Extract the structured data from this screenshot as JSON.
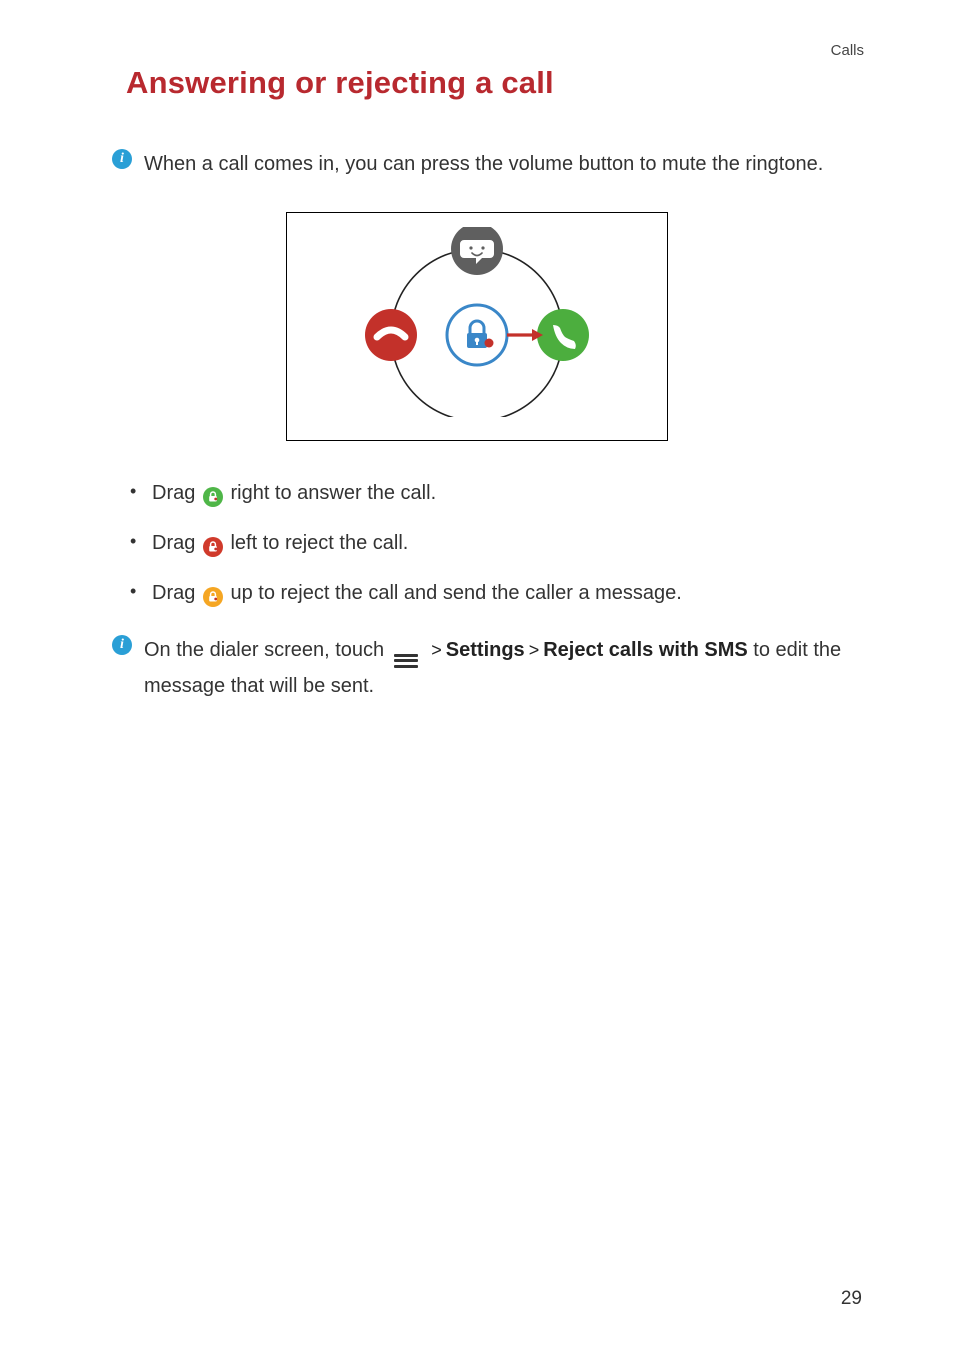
{
  "header": {
    "section": "Calls"
  },
  "title": "Answering or rejecting a call",
  "info1": "When a call comes in, you can press the volume button to mute the ringtone.",
  "bullets": {
    "b1_pre": "Drag ",
    "b1_post": " right to answer the call.",
    "b2_pre": "Drag ",
    "b2_post": " left to reject the call.",
    "b3_pre": "Drag ",
    "b3_post": " up to reject the call and send the caller a message."
  },
  "info2": {
    "pre": "On the dialer screen, touch ",
    "sep": " > ",
    "settings": "Settings",
    "reject": "Reject calls with SMS",
    "post": " to edit the message that will be sent."
  },
  "page_number": "29"
}
